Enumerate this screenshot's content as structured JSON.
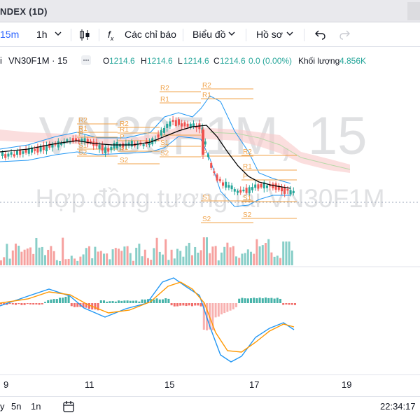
{
  "window": {
    "title": "NDEX (1D)"
  },
  "toolbar": {
    "interval_15m": "15m",
    "interval_1h": "1h",
    "indicators_label": "Các chỉ báo",
    "chart_type_label": "Biểu đồ",
    "profile_label": "Hồ sơ"
  },
  "legend": {
    "symbol": "VN30F1M · 15",
    "open_label": "O",
    "open": "1214.6",
    "high_label": "H",
    "high": "1214.6",
    "low_label": "L",
    "low": "1214.6",
    "close_label": "C",
    "close": "1214.6",
    "change": "0.0 (0.00%)",
    "volume_label": "Khối lượng",
    "volume": "4.856K"
  },
  "watermark": {
    "symbol": "VN30F1M, 15",
    "description": "Hợp đồng tương lai VN30F1M"
  },
  "pivot_labels": {
    "r2": "R2",
    "r1": "R1",
    "p": "P",
    "s1": "S1",
    "s2": "S2"
  },
  "time_axis": [
    "9",
    "11",
    "15",
    "17",
    "19"
  ],
  "bottom_bar": {
    "range_5d": "5n",
    "range_1m": "1n",
    "clock": "22:34:17"
  },
  "colors": {
    "up": "#26a69a",
    "down": "#ef5350",
    "pivot": "#f0a34a",
    "bollinger": "#2196f3",
    "kumo": "#f8c8c8",
    "ma_line": "#000000",
    "macd": "#2196f3",
    "signal": "#ff9800"
  }
}
